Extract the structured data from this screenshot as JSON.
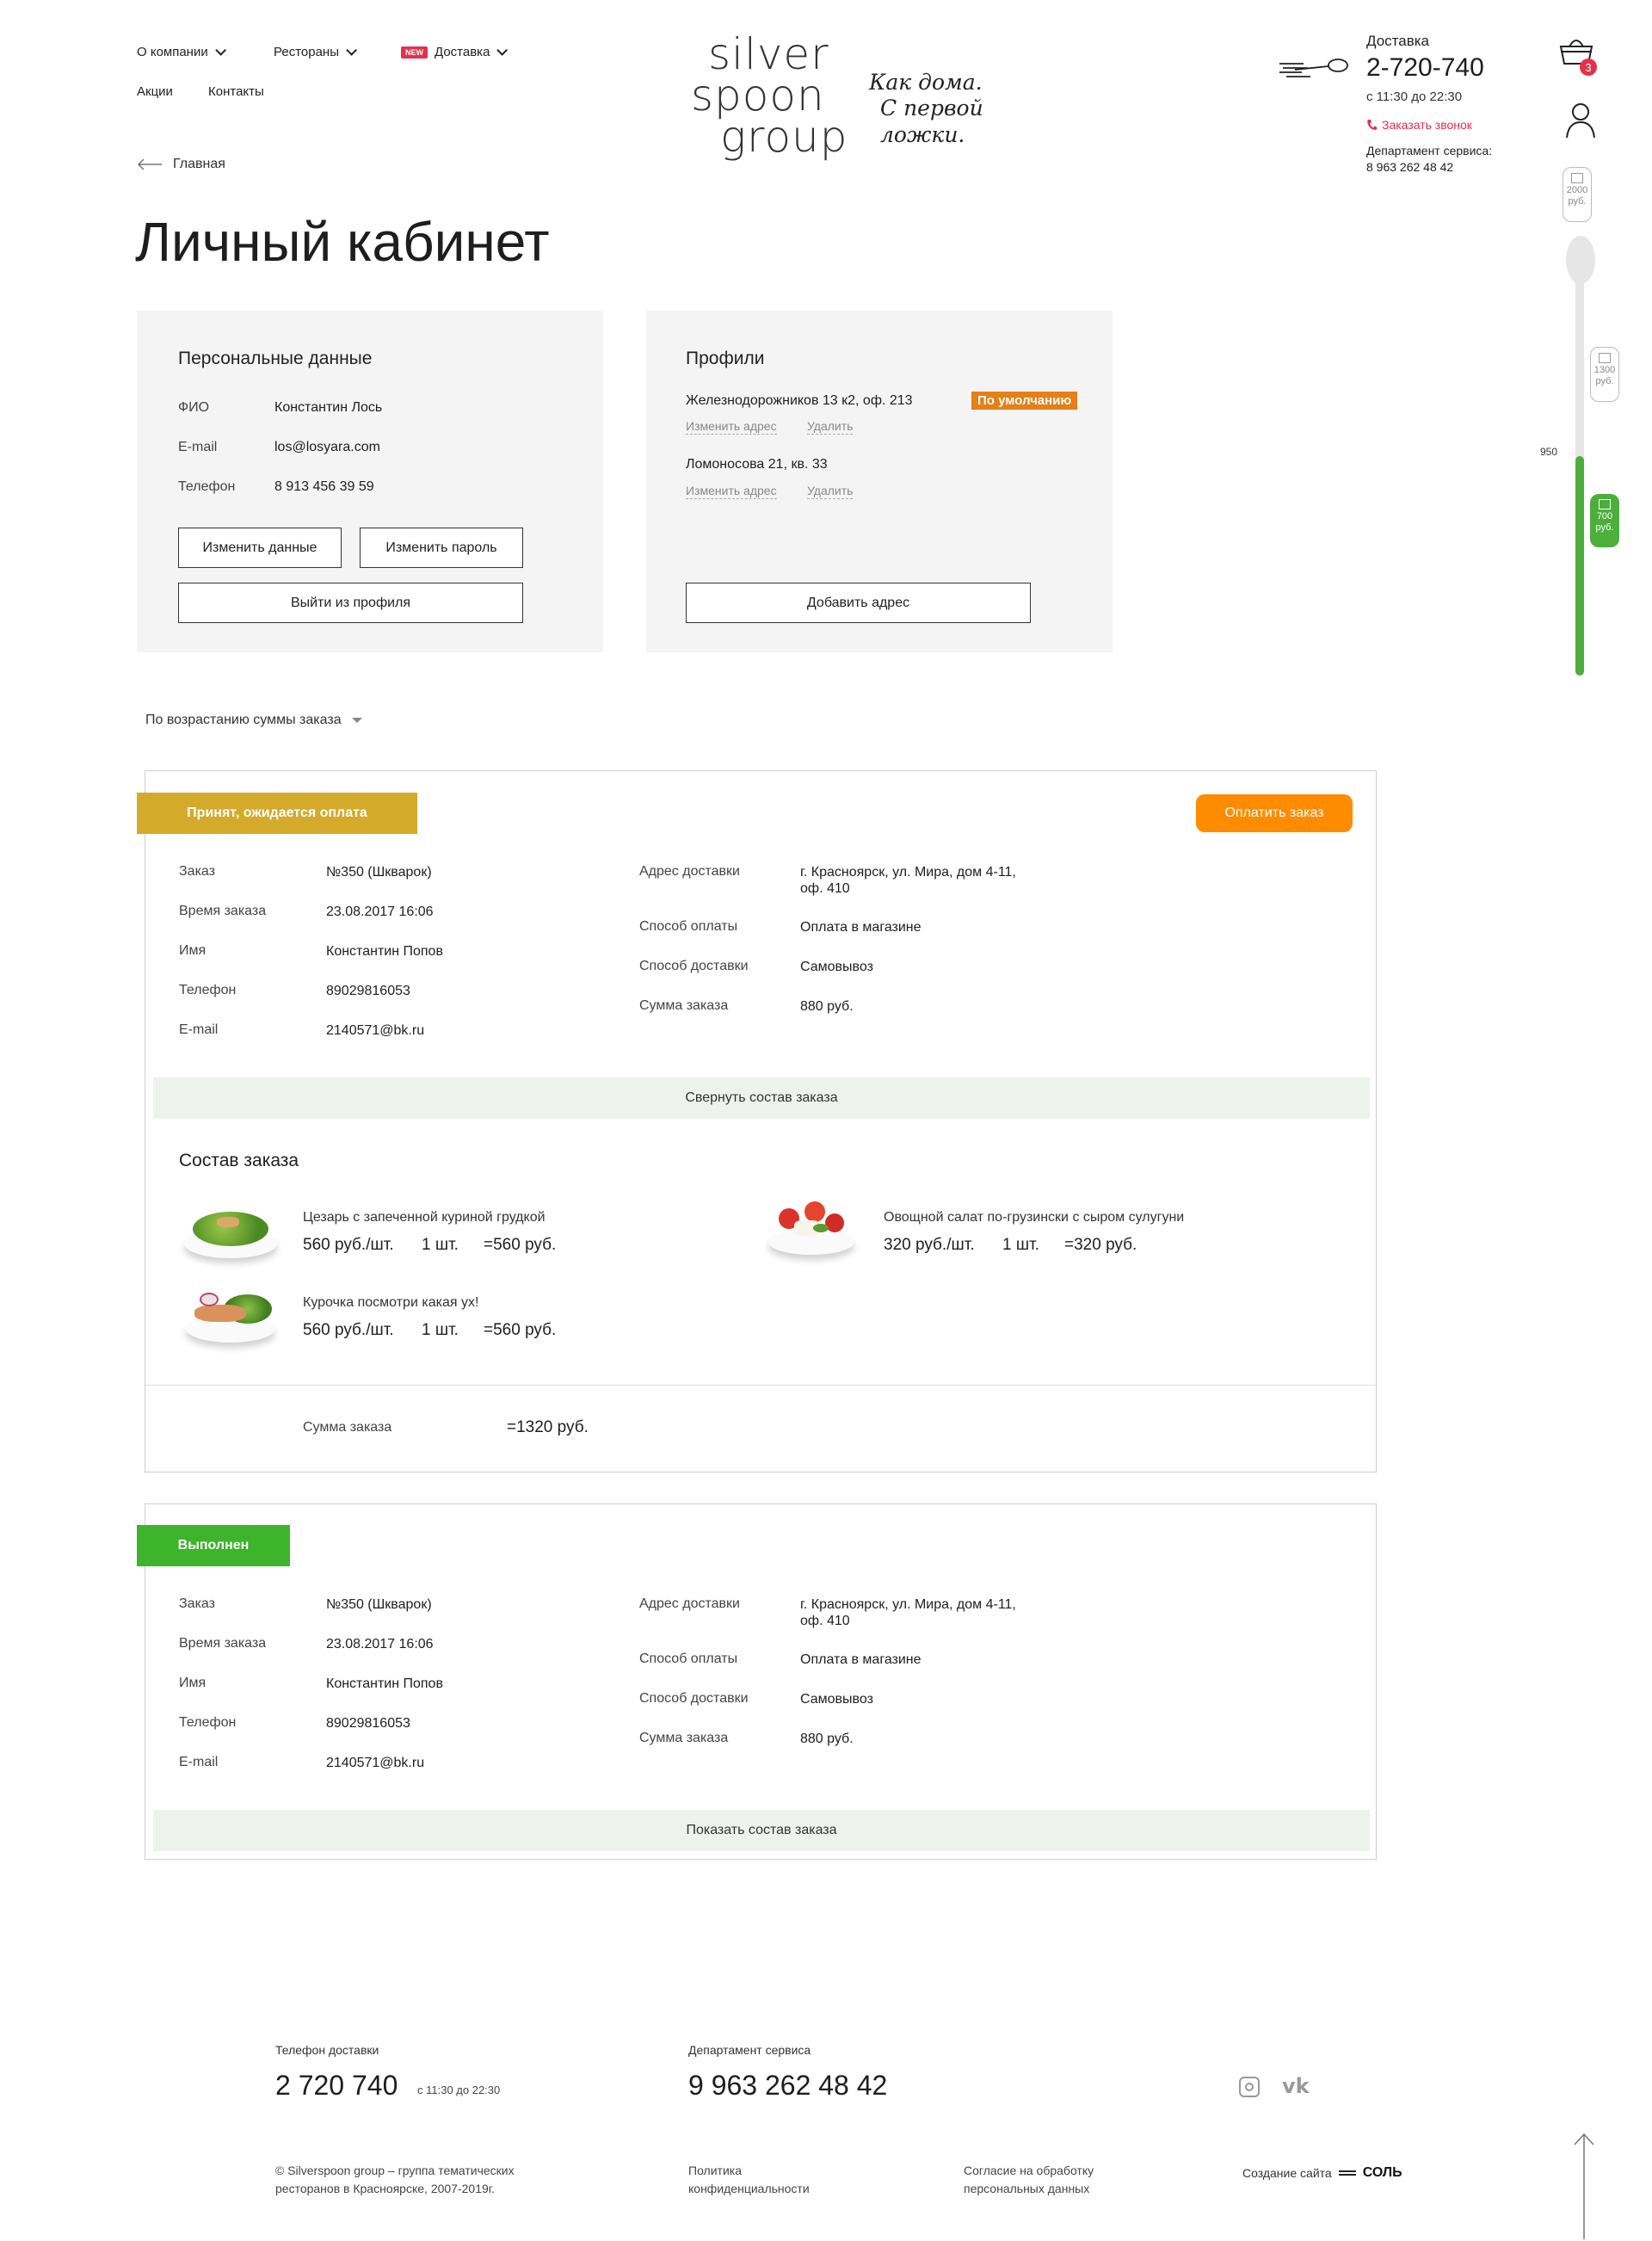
{
  "nav": {
    "items": [
      {
        "label": "О компании"
      },
      {
        "label": "Рестораны"
      },
      {
        "label": "Доставка",
        "badge": "NEW"
      },
      {
        "label": "Акции"
      },
      {
        "label": "Контакты"
      }
    ]
  },
  "logo": {
    "line1": "silver",
    "line2": "spoon",
    "line3": "group",
    "slogan_line1": "Как дома.",
    "slogan_line2": "С первой ложки."
  },
  "contact": {
    "delivery_label": "Доставка",
    "phone": "2-720-740",
    "hours": "с 11:30 до 22:30",
    "callback": "Заказать звонок",
    "service_label": "Департамент сервиса:",
    "service_phone": "8 963 262 48 42"
  },
  "cart": {
    "count": "3"
  },
  "progress": {
    "gift1": {
      "amount": "2000",
      "unit": "руб."
    },
    "gift2": {
      "amount": "1300",
      "unit": "руб."
    },
    "gift3": {
      "amount": "700",
      "unit": "руб."
    },
    "current_label": "950",
    "current_value": 950,
    "accent": "#4caf3c"
  },
  "breadcrumb": {
    "back_label": "Главная"
  },
  "page_title": "Личный кабинет",
  "personal": {
    "title": "Персональные данные",
    "fields": [
      {
        "label": "ФИО",
        "value": "Константин Лось"
      },
      {
        "label": "E-mail",
        "value": "los@losyara.com"
      },
      {
        "label": "Телефон",
        "value": "8 913 456 39 59"
      }
    ],
    "edit_data": "Изменить данные",
    "edit_password": "Изменить пароль",
    "logout": "Выйти из профиля"
  },
  "profiles": {
    "title": "Профили",
    "addresses": [
      {
        "address": "Железнодорожников 13 к2, оф. 213",
        "default_badge": "По умолчанию",
        "edit": "Изменить адрес",
        "delete": "Удалить"
      },
      {
        "address": "Ломоносова 21, кв. 33",
        "edit": "Изменить адрес",
        "delete": "Удалить"
      }
    ],
    "add_address": "Добавить адрес"
  },
  "sort": {
    "label": "По возрастанию суммы заказа"
  },
  "orders": [
    {
      "status": "Принят, ожидается оплата",
      "status_color": "#d4aa2a",
      "pay_button": "Оплатить заказ",
      "left": [
        {
          "label": "Заказ",
          "value": "№350 (Шкварок)"
        },
        {
          "label": "Время заказа",
          "value": "23.08.2017 16:06"
        },
        {
          "label": "Имя",
          "value": "Константин Попов"
        },
        {
          "label": "Телефон",
          "value": "89029816053"
        },
        {
          "label": "E-mail",
          "value": "2140571@bk.ru"
        }
      ],
      "right": [
        {
          "label": "Адрес доставки",
          "value": "г. Красноярск, ул. Мира, дом 4-11,",
          "value2": "оф. 410"
        },
        {
          "label": "Способ оплаты",
          "value": "Оплата в магазине"
        },
        {
          "label": "Способ доставки",
          "value": "Самовывоз"
        },
        {
          "label": "Сумма заказа",
          "value": "880 руб."
        }
      ],
      "toggle": "Свернуть состав заказа",
      "composition_title": "Состав заказа",
      "items": [
        {
          "name": "Цезарь с запеченной куриной грудкой",
          "price": "560 руб./шт.",
          "qty": "1 шт.",
          "total": "=560 руб."
        },
        {
          "name": "Овощной салат по-грузински с сыром сулугуни",
          "price": "320 руб./шт.",
          "qty": "1 шт.",
          "total": "=320 руб."
        },
        {
          "name": "Курочка посмотри какая ух!",
          "price": "560 руб./шт.",
          "qty": "1 шт.",
          "total": "=560 руб."
        }
      ],
      "sum_label": "Сумма заказа",
      "sum_value": "=1320 руб."
    },
    {
      "status": "Выполнен",
      "status_color": "#3db42c",
      "left": [
        {
          "label": "Заказ",
          "value": "№350 (Шкварок)"
        },
        {
          "label": "Время заказа",
          "value": "23.08.2017 16:06"
        },
        {
          "label": "Имя",
          "value": "Константин Попов"
        },
        {
          "label": "Телефон",
          "value": "89029816053"
        },
        {
          "label": "E-mail",
          "value": "2140571@bk.ru"
        }
      ],
      "right": [
        {
          "label": "Адрес доставки",
          "value": "г. Красноярск, ул. Мира, дом 4-11,",
          "value2": "оф. 410"
        },
        {
          "label": "Способ оплаты",
          "value": "Оплата в магазине"
        },
        {
          "label": "Способ доставки",
          "value": "Самовывоз"
        },
        {
          "label": "Сумма заказа",
          "value": "880 руб."
        }
      ],
      "toggle": "Показать состав заказа"
    }
  ],
  "footer": {
    "delivery_label": "Телефон доставки",
    "delivery_phone": "2 720 740",
    "delivery_hours": "с 11:30 до 22:30",
    "service_label": "Департамент сервиса",
    "service_phone": "9 963 262 48 42",
    "copyright_line1": "© Silverspoon group – группа тематических",
    "copyright_line2": "ресторанов в Красноярске, 2007-2019г.",
    "privacy_line1": "Политика",
    "privacy_line2": "конфиденциальности",
    "consent_line1": "Согласие на обработку",
    "consent_line2": "персональных данных",
    "made_by": "Создание сайта",
    "made_by_brand": "СОЛЬ"
  },
  "icons": [
    "chevron-down-icon",
    "arrow-left-icon",
    "basket-icon",
    "user-icon",
    "gift-icon",
    "spoon-icon",
    "phone-icon",
    "instagram-icon",
    "vk-icon",
    "arrow-up-icon"
  ]
}
